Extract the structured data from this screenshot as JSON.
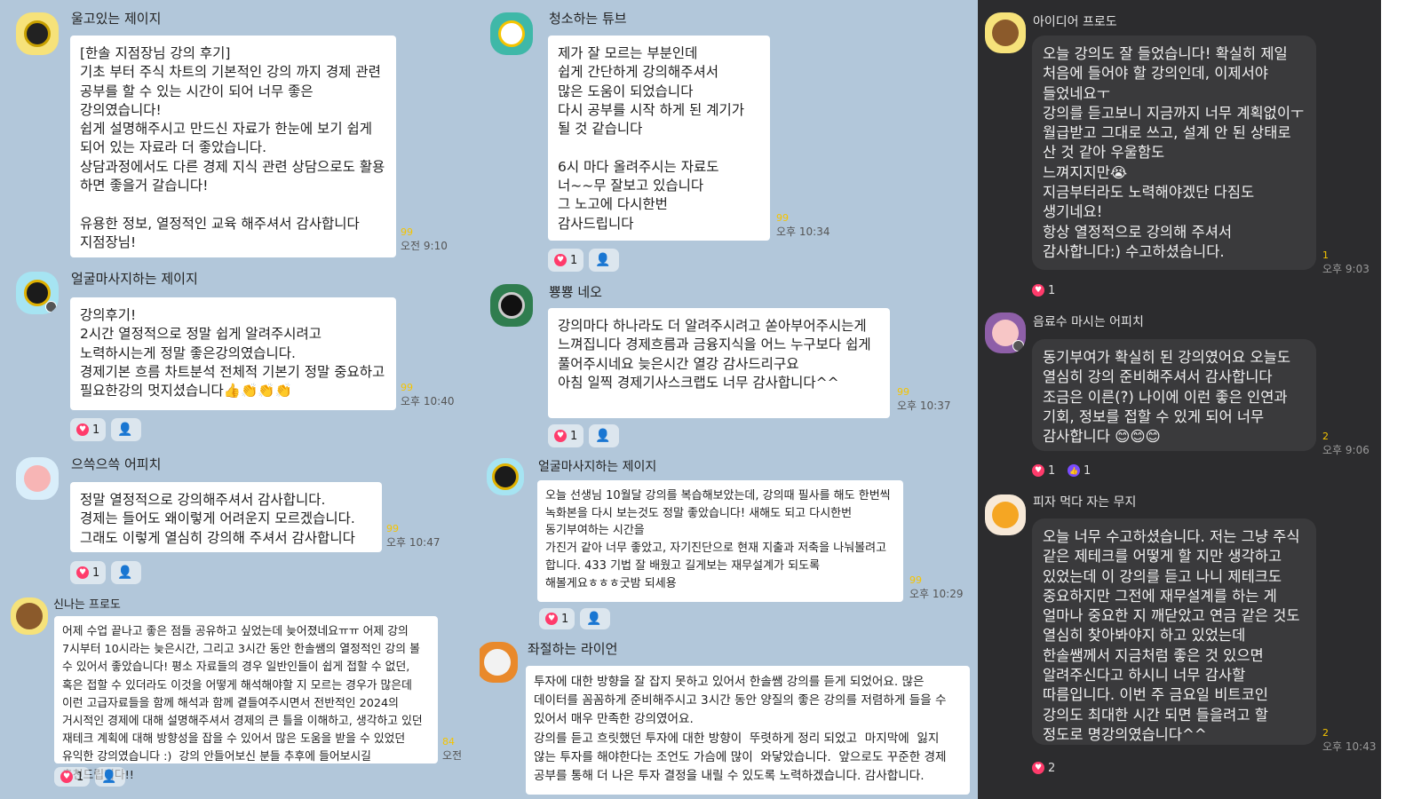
{
  "colors": {
    "chat_bg": "#b2c7da",
    "dark_bg": "#2c2c2e",
    "bubble_light": "#ffffff",
    "bubble_dark": "#3a3a3c",
    "heart": "#ff3b6b",
    "read_count": "#f5c400"
  },
  "col1": [
    {
      "name": "울고있는 제이지",
      "read": "99",
      "time": "오전 9:10",
      "text": "[한솔 지점장님 강의 후기]\n기초 부터 주식 차트의 기본적인 강의 까지 경제 관련 공부를 할 수 있는 시간이 되어 너무 좋은 강의였습니다!\n쉽게 설명해주시고 만드신 자료가 한눈에 보기 쉽게 되어 있는 자료라 더 좋았습니다.\n상담과정에서도 다른 경제 지식 관련 상담으로도 활용 하면 좋을거 갈습니다!\n\n유용한 정보, 열정적인 교육 해주셔서 감사합니다\n지점장님!"
    },
    {
      "name": "얼굴마사지하는 제이지",
      "read": "99",
      "time": "오후 10:40",
      "heart": "1",
      "text": "강의후기!\n2시간 열정적으로 정말 쉽게 알려주시려고 노력하시는게 정말 좋은강의였습니다.\n경제기본 흐름 차트분석 전체적 기본기 정말 중요하고 필요한강의 멋지셨습니다👍👏👏👏"
    },
    {
      "name": "으쓱으쓱 어피치",
      "read": "99",
      "time": "오후 10:47",
      "heart": "1",
      "text": "정말 열정적으로 강의해주셔서 감사합니다.\n경제는 들어도 왜이렇게 어려운지 모르겠습니다.\n그래도 이렇게 열심히 강의해 주셔서 감사합니다"
    },
    {
      "name": "신나는 프로도",
      "read": "84",
      "time": "오전",
      "heart": "1",
      "text": "어제 수업 끝나고 좋은 점들 공유하고 싶었는데 늦어졌네요ㅠㅠ 어제 강의 7시부터 10시라는 늦은시간, 그리고 3시간 동안 한솔쌤의 열정적인 강의 볼 수 있어서 좋았습니다! 평소 자료들의 경우 일반인들이 쉽게 접할 수 없던, 혹은 접할 수 있더라도 이것을 어떻게 해석해야할 지 모르는 경우가 많은데 이런 고급자료들을 함께 해석과 함께 곁들여주시면서 전반적인 2024의 거시적인 경제에 대해 설명해주셔서 경제의 큰 틀을 이해하고, 생각하고 있던 재테크 계획에 대해 방향성을 잡을 수 있어서 많은 도움을 받을 수 있었던 유익한 강의였습니다 :)  강의 안들어보신 분들 추후에 들어보시길 추천드립니다!!"
    }
  ],
  "col2": [
    {
      "name": "청소하는 튜브",
      "read": "99",
      "time": "오후 10:34",
      "heart": "1",
      "text": "제가 잘 모르는 부분인데\n쉽게 간단하게 강의해주셔서\n많은 도움이 되었습니다\n다시 공부를 시작 하게 된 계기가 될 것 같습니다\n\n6시 마다 올려주시는 자료도\n너~~무 잘보고 있습니다\n그 노고에 다시한번\n감사드립니다"
    },
    {
      "name": "뿅뿅 네오",
      "read": "99",
      "time": "오후 10:37",
      "heart": "1",
      "text": "강의마다 하나라도 더 알려주시려고 쏟아부어주시는게 느껴집니다 경제흐름과 금융지식을 어느 누구보다 쉽게 풀어주시네요 늦은시간 열강 감사드리구요\n아침 일찍 경제기사스크랩도 너무 감사합니다^^"
    },
    {
      "name": "얼굴마사지하는 제이지",
      "read": "99",
      "time": "오후 10:29",
      "heart": "1",
      "text": "오늘 선생님 10월달 강의를 복습해보았는데, 강의때 필사를 해도 한번씩 녹화본을 다시 보는것도 정말 좋았습니다! 새해도 되고 다시한번 동기부여하는 시간을\n가진거 같아 너무 좋았고, 자기진단으로 현재 지출과 저축을 나눠볼려고 합니다. 433 기법 잘 배웠고 길게보는 재무설계가 되도록 해볼게요ㅎㅎㅎ굿밤 되세용"
    },
    {
      "name": "좌절하는 라이언",
      "text": "투자에 대한 방향을 잘 잡지 못하고 있어서 한솔쌤 강의를 듣게 되었어요. 많은 데이터를 꼼꼼하게 준비해주시고 3시간 동안 양질의 좋은 강의를 저렴하게 들을 수 있어서 매우 만족한 강의였어요.\n강의를 듣고 흐릿했던 투자에 대한 방향이  뚜렷하게 정리 되었고  마지막에  잃지 않는 투자를 해야한다는 조언도 가슴에 많이  와닿았습니다.  앞으로도 꾸준한 경제 공부를 통해 더 나은 투자 결정을 내릴 수 있도록 노력하겠습니다. 감사합니다."
    }
  ],
  "col3": [
    {
      "name": "아이디어 프로도",
      "read": "1",
      "time": "오후 9:03",
      "heart": "1",
      "text": "오늘 강의도 잘 들었습니다! 확실히 제일 처음에 들어야 할 강의인데, 이제서야 들었네요ㅜ\n강의를 듣고보니 지금까지 너무 계획없이ㅜ 월급받고 그대로 쓰고, 설계 안 된 상태로 산 것 같아 우울함도\n느껴지지만😭\n지금부터라도 노력해야겠단 다짐도\n생기네요!\n항상 열정적으로 강의해 주셔서\n감사합니다:) 수고하셨습니다."
    },
    {
      "name": "음료수 마시는 어피치",
      "read": "2",
      "time": "오후 9:06",
      "heart": "1",
      "thumb": "1",
      "text": "동기부여가 확실히 된 강의였어요 오늘도 열심히 강의 준비해주셔서 감사합니다\n조금은 이른(?) 나이에 이런 좋은 인연과 기회, 정보를 접할 수 있게 되어 너무\n감사합니다 😊😊😊"
    },
    {
      "name": "피자 먹다 자는 무지",
      "read": "2",
      "time": "오후 10:43",
      "heart": "2",
      "text": "오늘 너무 수고하셨습니다. 저는 그냥 주식 같은 제테크를 어떻게 할 지만 생각하고 있었는데 이 강의를 듣고 나니 제테크도 중요하지만 그전에 재무설계를 하는 게 얼마나 중요한 지 깨닫았고 연금 같은 것도 열심히 찾아봐야지 하고 있었는데 한솔쌤께서 지금처럼 좋은 것 있으면 알려주신다고 하시니 너무 감사할 따름입니다. 이번 주 금요일 비트코인 강의도 최대한 시간 되면 들을려고 할 정도로 명강의였습니다^^"
    }
  ]
}
